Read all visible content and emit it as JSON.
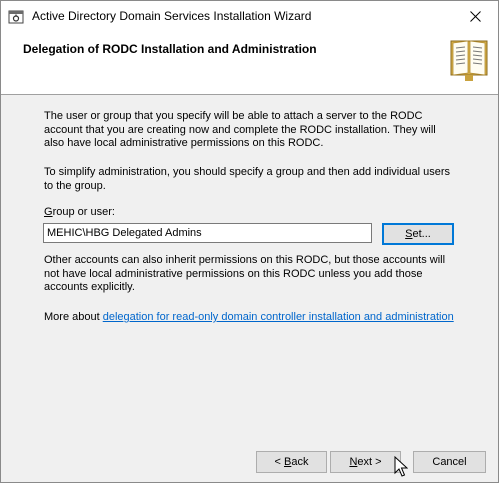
{
  "window": {
    "title": "Active Directory Domain Services Installation Wizard"
  },
  "header": {
    "title": "Delegation of RODC Installation and Administration"
  },
  "content": {
    "paragraph1": "The user or group that you specify will be able to attach a server to the RODC account that you are creating now and complete the RODC installation. They will also have local administrative permissions on this RODC.",
    "paragraph2": "To simplify administration, you should specify a group and then add individual users to the group.",
    "group_label_underlined": "G",
    "group_label_rest": "roup or user:",
    "group_value": "MEHIC\\HBG Delegated Admins",
    "set_button_underlined": "S",
    "set_button_rest": "et...",
    "paragraph3": "Other accounts can also inherit permissions on this RODC, but those accounts will not have local administrative permissions on this RODC unless you add those accounts explicitly.",
    "more_about_prefix": "More about",
    "more_about_link": "delegation for read-only domain controller installation and administration"
  },
  "footer": {
    "back_prefix": "< ",
    "back_underlined": "B",
    "back_rest": "ack",
    "next_underlined": "N",
    "next_rest": "ext >",
    "cancel_label": "Cancel"
  },
  "icons": {
    "app": "server-wizard-icon",
    "header": "book-icon",
    "close": "close-icon",
    "cursor": "mouse-pointer-icon"
  },
  "colors": {
    "focus_border": "#0078d7",
    "link": "#0066cc",
    "dialog_bg": "#f0f0f0"
  }
}
